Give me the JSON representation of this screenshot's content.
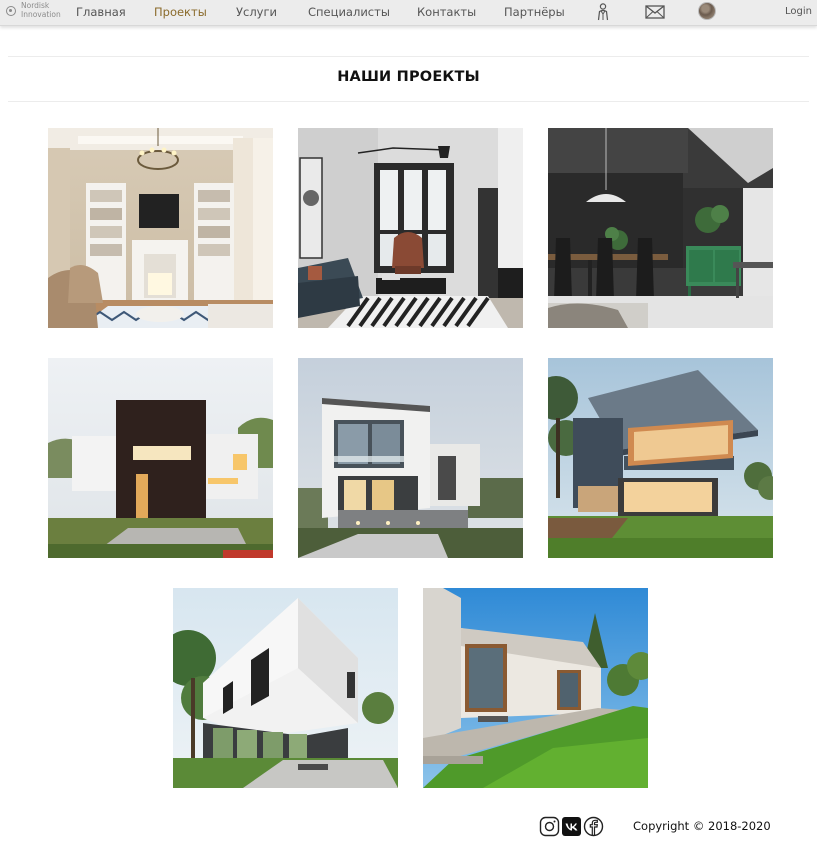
{
  "nav": {
    "logo_text": "Nordisk\nInnovation",
    "links": [
      {
        "label": "Главная",
        "active": false
      },
      {
        "label": "Проекты",
        "active": true
      },
      {
        "label": "Услуги",
        "active": false
      },
      {
        "label": "Специалисты",
        "active": false
      },
      {
        "label": "Контакты",
        "active": false
      },
      {
        "label": "Партнёры",
        "active": false
      }
    ],
    "login_label": "Login",
    "active_color": "#8a6a2a"
  },
  "page": {
    "title": "НАШИ ПРОЕКТЫ"
  },
  "projects": [
    {
      "subject": "classic living room interior with fireplace"
    },
    {
      "subject": "dark modern living room interior"
    },
    {
      "subject": "dark dining room interior with green cabinet"
    },
    {
      "subject": "modern house with dark facade"
    },
    {
      "subject": "white modern house at dusk"
    },
    {
      "subject": "cantilevered modern house with lawn"
    },
    {
      "subject": "white cantilevered house with glass ground floor"
    },
    {
      "subject": "concrete house with lawn and blue sky"
    }
  ],
  "footer": {
    "social_icons": [
      "instagram-icon",
      "vk-icon",
      "facebook-icon"
    ],
    "copyright": "Copyright © 2018-2020"
  }
}
